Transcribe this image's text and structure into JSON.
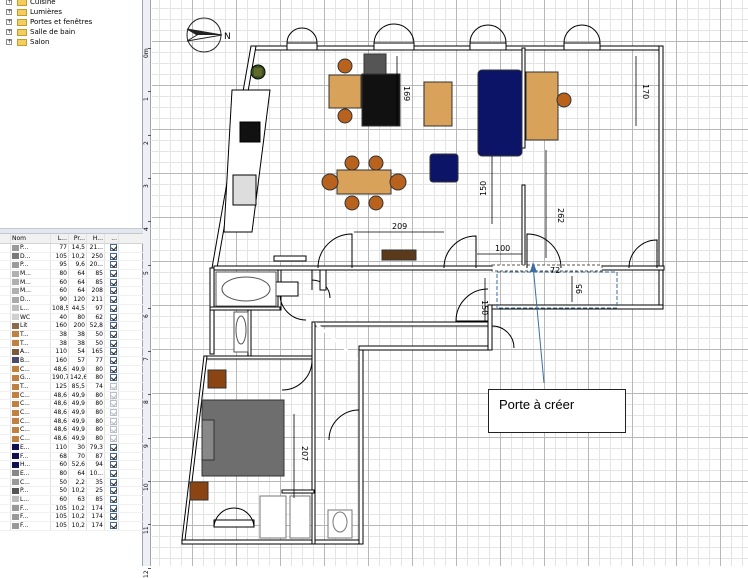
{
  "tree": {
    "items": [
      {
        "label": "Cuisine"
      },
      {
        "label": "Lumières"
      },
      {
        "label": "Portes et fenêtres"
      },
      {
        "label": "Salle de bain"
      },
      {
        "label": "Salon"
      }
    ]
  },
  "furniture_table": {
    "columns": [
      "Nom",
      "L...",
      "Pr...",
      "H...",
      "..."
    ],
    "rows": [
      {
        "name": "P...",
        "w": "77",
        "d": "14,5",
        "h": "21...",
        "v": true
      },
      {
        "name": "D...",
        "w": "105",
        "d": "10,2",
        "h": "250",
        "v": true
      },
      {
        "name": "P...",
        "w": "95",
        "d": "9,6",
        "h": "20...",
        "v": true
      },
      {
        "name": "M...",
        "w": "80",
        "d": "64",
        "h": "85",
        "v": true
      },
      {
        "name": "M...",
        "w": "60",
        "d": "64",
        "h": "85",
        "v": true
      },
      {
        "name": "M...",
        "w": "60",
        "d": "64",
        "h": "208",
        "v": true
      },
      {
        "name": "D...",
        "w": "90",
        "d": "120",
        "h": "211",
        "v": true
      },
      {
        "name": "L...",
        "w": "108,5",
        "d": "44,5",
        "h": "97",
        "v": true
      },
      {
        "name": "WC",
        "w": "40",
        "d": "80",
        "h": "62",
        "v": true
      },
      {
        "name": "Lit",
        "w": "160",
        "d": "200",
        "h": "52,8",
        "v": true
      },
      {
        "name": "T...",
        "w": "38",
        "d": "38",
        "h": "50",
        "v": true
      },
      {
        "name": "T...",
        "w": "38",
        "d": "38",
        "h": "50",
        "v": true
      },
      {
        "name": "A...",
        "w": "110",
        "d": "54",
        "h": "165",
        "v": true
      },
      {
        "name": "B...",
        "w": "160",
        "d": "57",
        "h": "77",
        "v": true
      },
      {
        "name": "C...",
        "w": "48,6",
        "d": "49,9",
        "h": "80",
        "v": true
      },
      {
        "name": "G...",
        "w": "190,7",
        "d": "142,6",
        "h": "80",
        "v": true
      },
      {
        "name": "T...",
        "w": "125",
        "d": "85,5",
        "h": "74",
        "v": false
      },
      {
        "name": "C...",
        "w": "48,6",
        "d": "49,9",
        "h": "80",
        "v": false
      },
      {
        "name": "C...",
        "w": "48,6",
        "d": "49,9",
        "h": "80",
        "v": false
      },
      {
        "name": "C...",
        "w": "48,6",
        "d": "49,9",
        "h": "80",
        "v": false
      },
      {
        "name": "C...",
        "w": "48,6",
        "d": "49,9",
        "h": "80",
        "v": false
      },
      {
        "name": "C...",
        "w": "48,6",
        "d": "49,9",
        "h": "80",
        "v": false
      },
      {
        "name": "C...",
        "w": "48,6",
        "d": "49,9",
        "h": "80",
        "v": false
      },
      {
        "name": "E...",
        "w": "110",
        "d": "30",
        "h": "79,3",
        "v": true
      },
      {
        "name": "F...",
        "w": "68",
        "d": "70",
        "h": "87",
        "v": true
      },
      {
        "name": "H...",
        "w": "60",
        "d": "52,6",
        "h": "94",
        "v": true
      },
      {
        "name": "E...",
        "w": "80",
        "d": "64",
        "h": "10...",
        "v": true
      },
      {
        "name": "C...",
        "w": "50",
        "d": "2,2",
        "h": "35",
        "v": true
      },
      {
        "name": "P...",
        "w": "50",
        "d": "10,2",
        "h": "25",
        "v": true
      },
      {
        "name": "L...",
        "w": "60",
        "d": "63",
        "h": "85",
        "v": true
      },
      {
        "name": "F...",
        "w": "105",
        "d": "10,2",
        "h": "174",
        "v": true
      },
      {
        "name": "F...",
        "w": "105",
        "d": "10,2",
        "h": "174",
        "v": true
      },
      {
        "name": "F...",
        "w": "105",
        "d": "10,2",
        "h": "174",
        "v": true
      }
    ]
  },
  "ruler": {
    "marks": [
      "0m",
      "1",
      "2",
      "3",
      "4",
      "5",
      "6",
      "7",
      "8",
      "9",
      "10",
      "11",
      "12"
    ]
  },
  "plan": {
    "compass_label": "N",
    "dimensions": {
      "d169": "169",
      "d170": "170",
      "d150a": "150",
      "d262": "262",
      "d209": "209",
      "d100": "100",
      "d72": "72",
      "d150b": "150",
      "d95": "95",
      "d207": "207"
    },
    "callout": "Porte à créer",
    "colors": {
      "wall": "#000000",
      "sofa": "#0c1468",
      "table": "#d9a25a",
      "chair": "#b8621e",
      "bed": "#6e6e6e",
      "arrow": "#3a6ea5"
    }
  }
}
